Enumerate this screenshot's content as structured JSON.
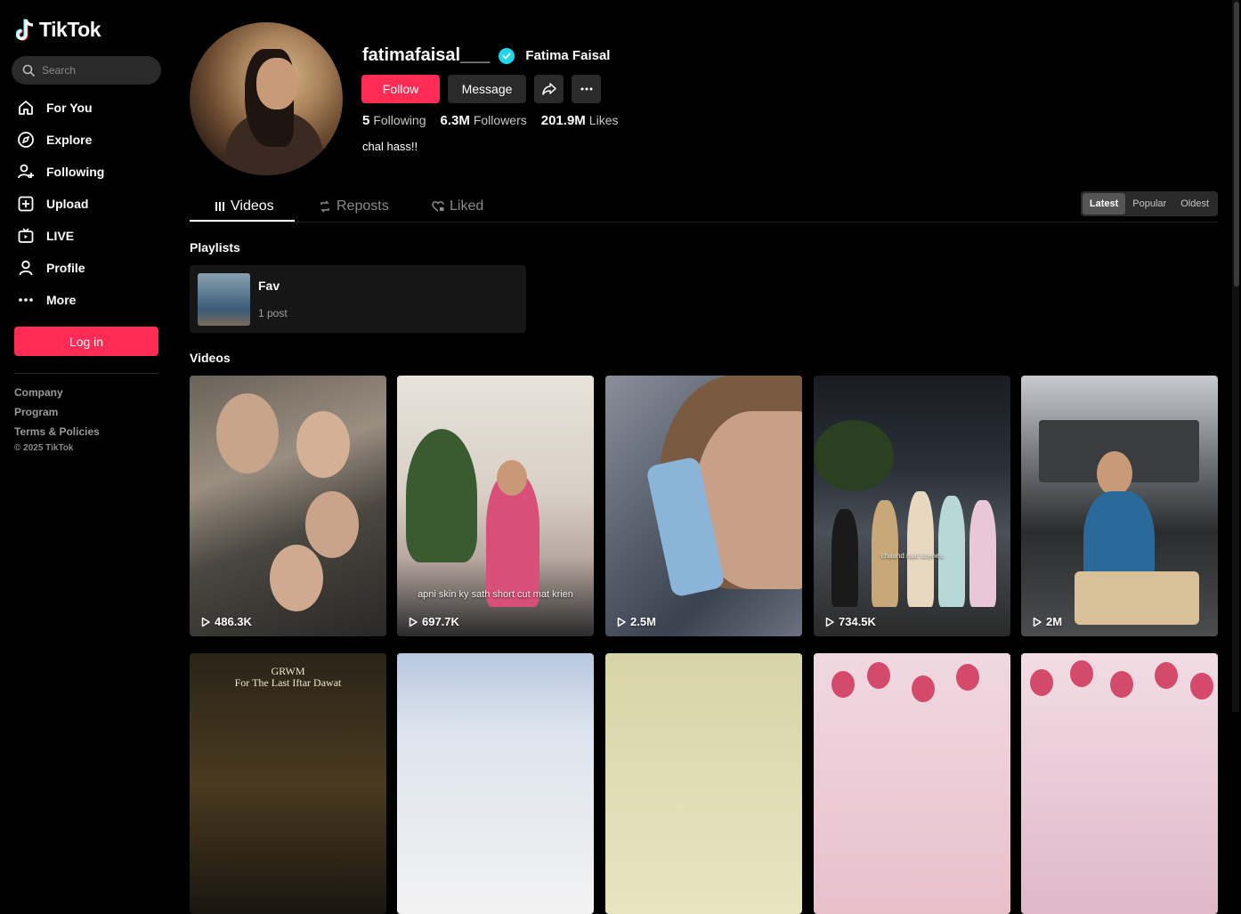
{
  "brand": {
    "name": "TikTok",
    "accent": "#fe2c55"
  },
  "search": {
    "placeholder": "Search"
  },
  "sidebar": {
    "items": [
      {
        "label": "For You",
        "icon": "home-icon"
      },
      {
        "label": "Explore",
        "icon": "compass-icon"
      },
      {
        "label": "Following",
        "icon": "person-add-icon"
      },
      {
        "label": "Upload",
        "icon": "plus-square-icon"
      },
      {
        "label": "LIVE",
        "icon": "live-tv-icon"
      },
      {
        "label": "Profile",
        "icon": "person-icon"
      },
      {
        "label": "More",
        "icon": "more-dots-icon"
      }
    ],
    "login_label": "Log in",
    "footer_links": [
      "Company",
      "Program",
      "Terms & Policies"
    ],
    "copyright": "© 2025 TikTok"
  },
  "profile": {
    "username": "fatimafaisal___",
    "display_name": "Fatima Faisal",
    "verified": true,
    "follow_label": "Follow",
    "message_label": "Message",
    "following_count": "5",
    "following_label": "Following",
    "followers_count": "6.3M",
    "followers_label": "Followers",
    "likes_count": "201.9M",
    "likes_label": "Likes",
    "bio": "chal hass!!"
  },
  "tabs": [
    {
      "label": "Videos",
      "active": true
    },
    {
      "label": "Reposts",
      "active": false
    },
    {
      "label": "Liked",
      "active": false
    }
  ],
  "sort": {
    "options": [
      "Latest",
      "Popular",
      "Oldest"
    ],
    "selected": "Latest"
  },
  "playlists": {
    "title": "Playlists",
    "items": [
      {
        "name": "Fav",
        "count": "1 post"
      }
    ]
  },
  "videos": {
    "title": "Videos",
    "items": [
      {
        "views": "486.3K",
        "caption": ""
      },
      {
        "views": "697.7K",
        "caption": "apni skin ky sath short cut mat krien"
      },
      {
        "views": "2.5M",
        "caption": ""
      },
      {
        "views": "734.5K",
        "caption": "chaand raat scenes"
      },
      {
        "views": "2M",
        "caption": ""
      },
      {
        "views": "",
        "title_line1": "GRWM",
        "title_line2": "For The Last Iftar Dawat"
      },
      {
        "views": ""
      },
      {
        "views": ""
      },
      {
        "views": ""
      },
      {
        "views": ""
      }
    ]
  }
}
